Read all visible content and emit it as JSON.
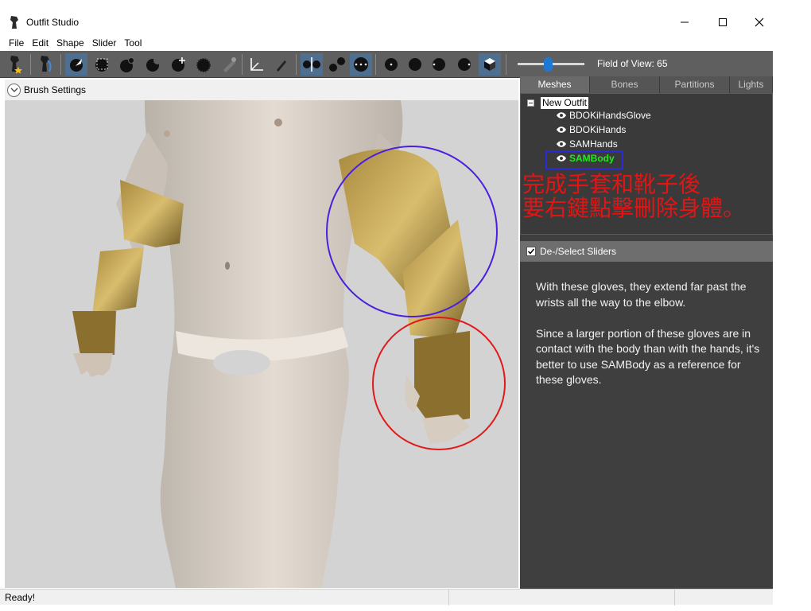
{
  "window": {
    "title": "Outfit Studio"
  },
  "menu": [
    "File",
    "Edit",
    "Shape",
    "Slider",
    "Tool"
  ],
  "toolbar": {
    "fov_label": "Field of View: 65",
    "fov_value": 65,
    "accent": "#1f78d1"
  },
  "brush_settings": {
    "label": "Brush Settings"
  },
  "tabs": [
    "Meshes",
    "Bones",
    "Partitions",
    "Lights"
  ],
  "tree": {
    "root": "New Outfit",
    "items": [
      "BDOKiHandsGlove",
      "BDOKiHands",
      "SAMHands",
      "SAMBody"
    ],
    "selected": "SAMBody"
  },
  "annotation": {
    "line1": "完成手套和靴子後",
    "line2": "要右鍵點擊刪除身體。",
    "color": "#e21515"
  },
  "sliders": {
    "label": "De-/Select Sliders",
    "checked": true
  },
  "note": {
    "para1": "With these gloves, they extend far past the wrists all the way to the elbow.",
    "para2": "Since a larger portion of these gloves are in contact with the body than with the hands, it's better to use SAMBody as a reference for these gloves."
  },
  "status": {
    "text": "Ready!"
  }
}
